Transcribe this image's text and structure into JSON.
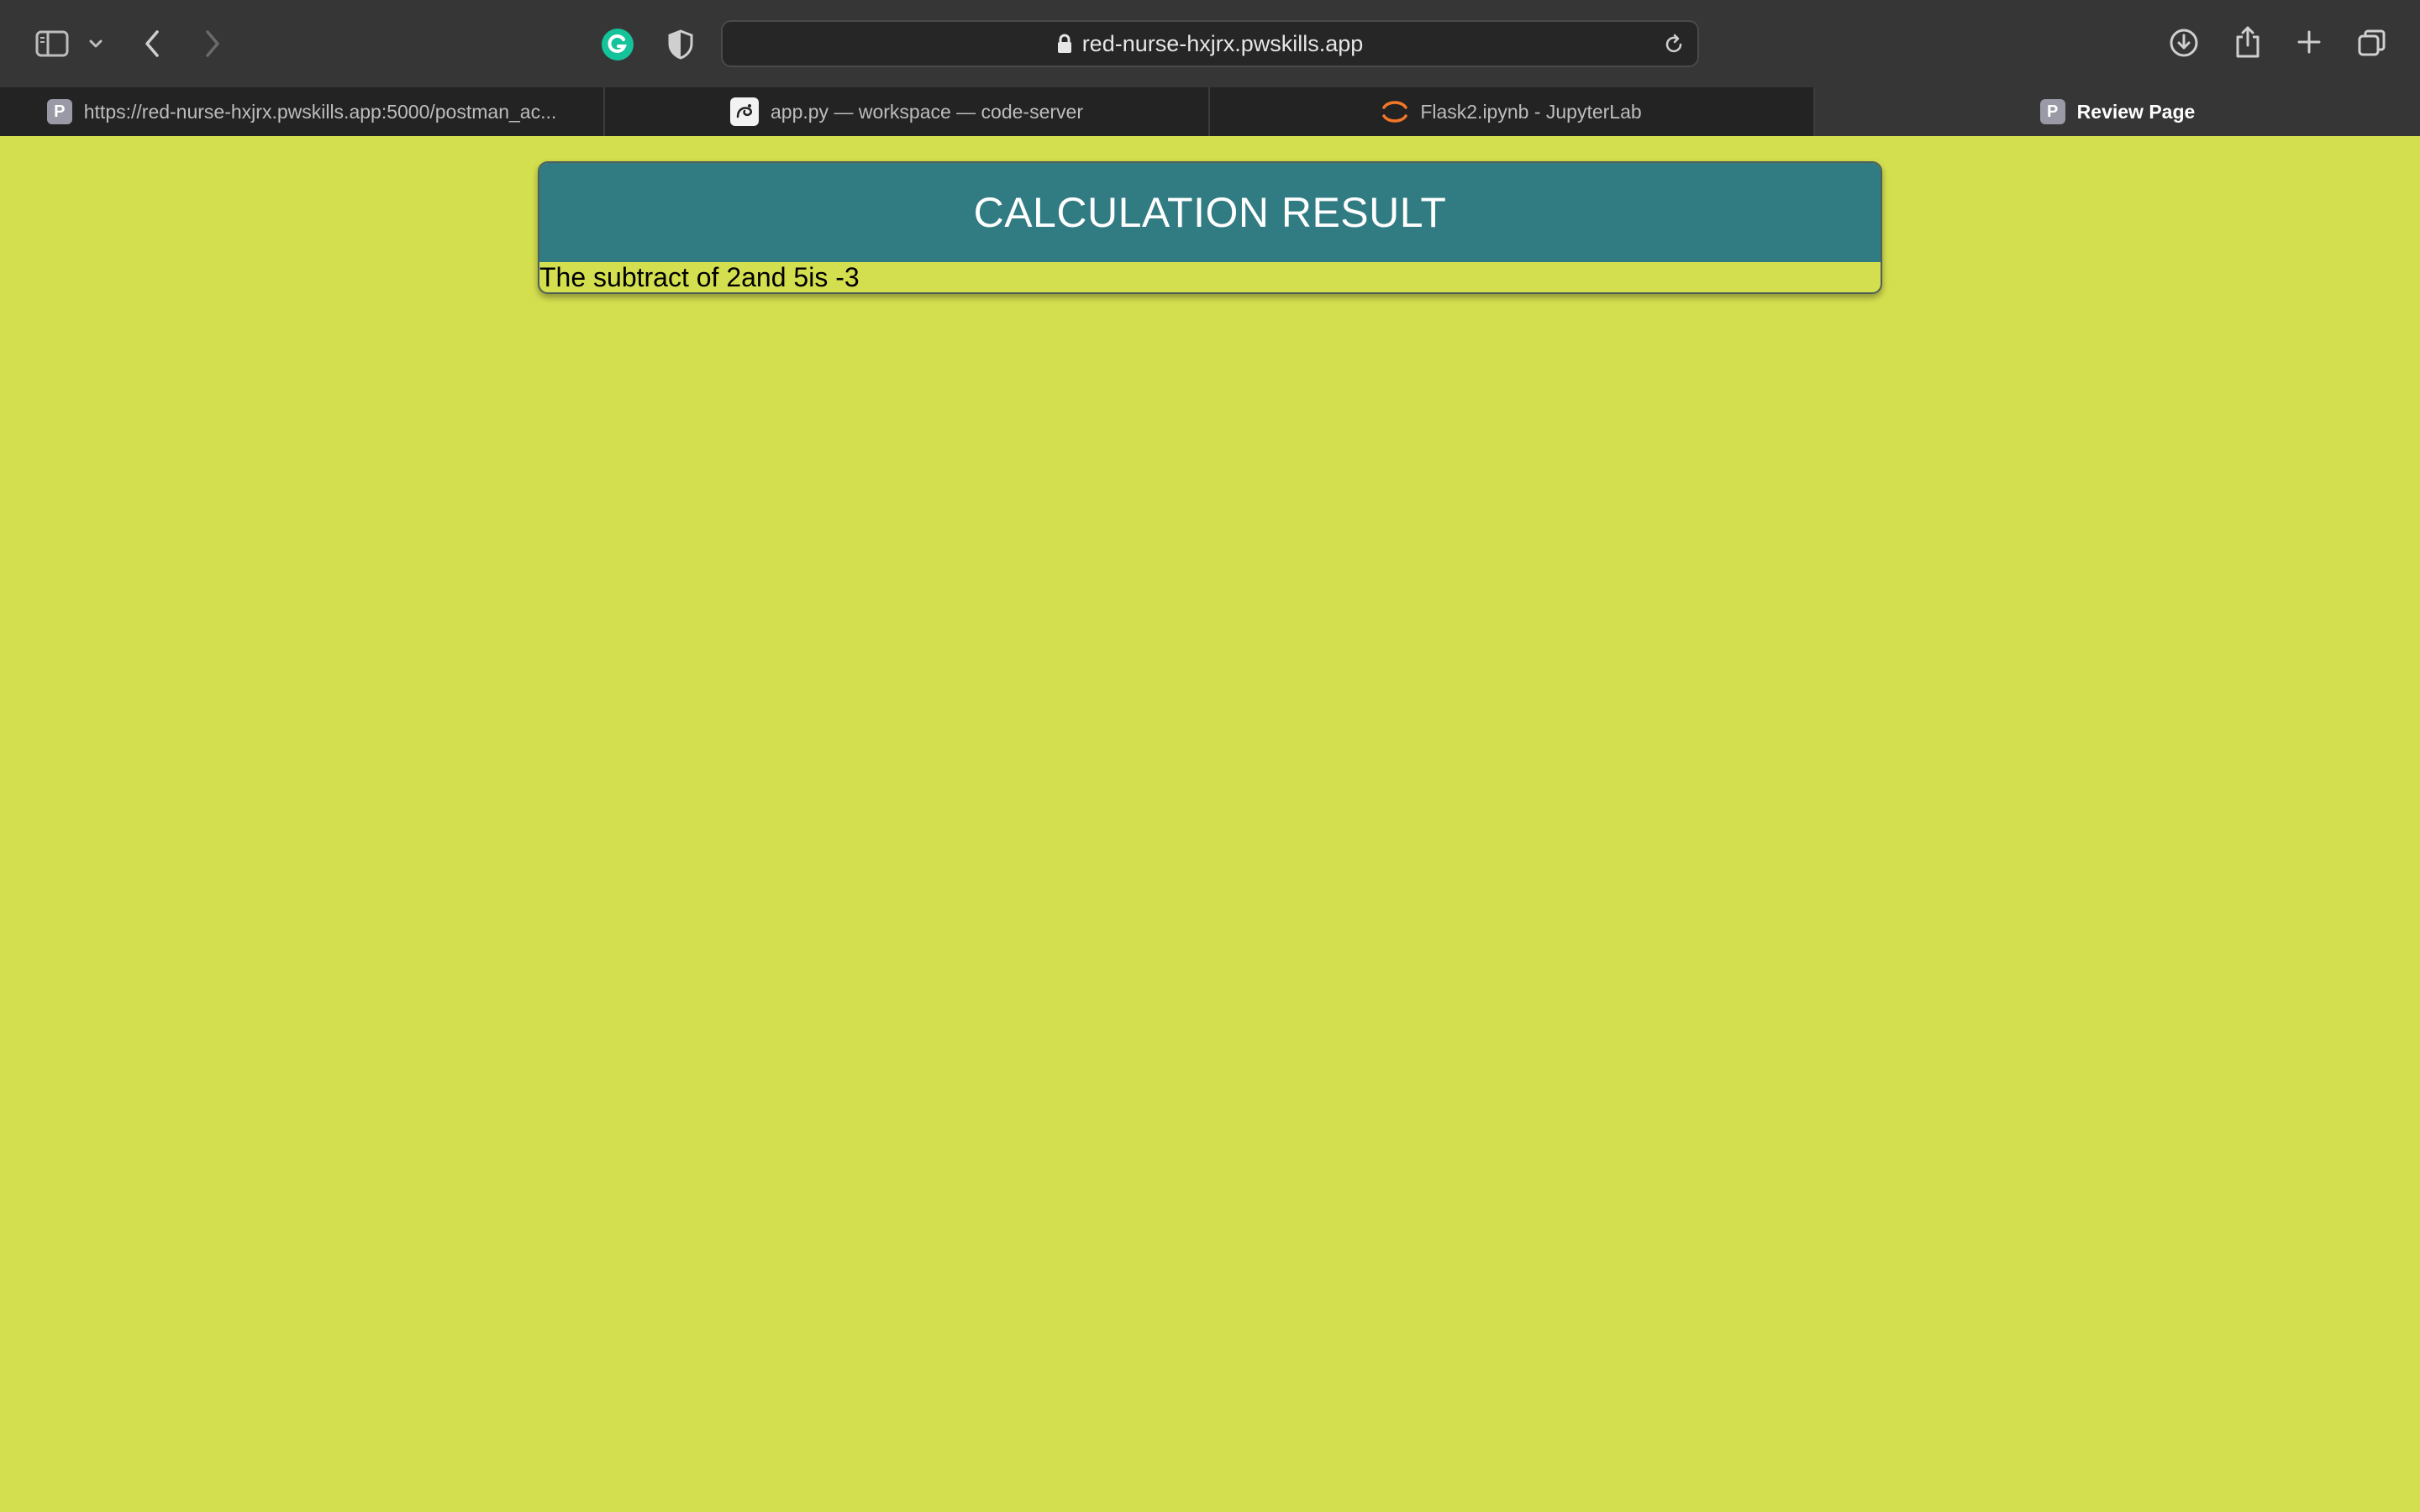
{
  "browser": {
    "address": "red-nurse-hxjrx.pwskills.app",
    "tabs": [
      {
        "favicon": "P",
        "label": "https://red-nurse-hxjrx.pwskills.app:5000/postman_ac...",
        "active": false
      },
      {
        "favicon": "code-server-icon",
        "label": "app.py — workspace — code-server",
        "active": false
      },
      {
        "favicon": "jupyter-icon",
        "label": "Flask2.ipynb - JupyterLab",
        "active": false
      },
      {
        "favicon": "P",
        "label": "Review Page",
        "active": true
      }
    ],
    "colors": {
      "toolbar": "#363636",
      "tabbar": "#232323",
      "grammarly_green": "#15c39a"
    }
  },
  "page": {
    "title": "CALCULATION RESULT",
    "result_text": "The subtract of 2and 5is -3",
    "colors": {
      "background": "#d4df4f",
      "header": "#317b82",
      "title_text": "#ffffff"
    }
  }
}
